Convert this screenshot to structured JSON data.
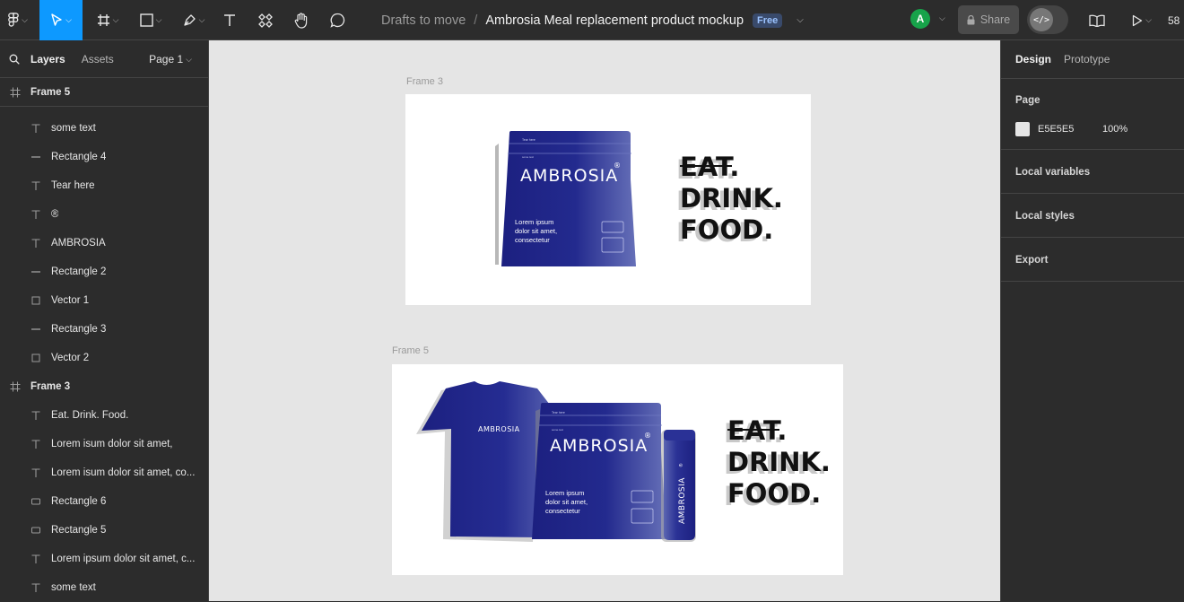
{
  "toolbar": {
    "tools": [
      {
        "name": "main-menu-icon"
      },
      {
        "name": "move-tool-icon",
        "active": true
      },
      {
        "name": "frame-tool-icon"
      },
      {
        "name": "shape-tool-icon"
      },
      {
        "name": "pen-tool-icon"
      },
      {
        "name": "text-tool-icon"
      },
      {
        "name": "components-icon"
      },
      {
        "name": "hand-tool-icon"
      },
      {
        "name": "comment-icon"
      }
    ],
    "breadcrumb_folder": "Drafts to move",
    "breadcrumb_sep": "/",
    "file_title": "Ambrosia Meal replacement product mockup",
    "plan_badge": "Free",
    "avatar_initial": "A",
    "share_label": "Share",
    "zoom_partial": "58"
  },
  "left_panel": {
    "tabs": {
      "layers": "Layers",
      "assets": "Assets"
    },
    "page_selector": "Page 1",
    "layers": [
      {
        "label": "Frame 5",
        "type": "frame"
      },
      {
        "label": "some text",
        "type": "text"
      },
      {
        "label": "Rectangle 4",
        "type": "line"
      },
      {
        "label": "Tear here",
        "type": "text"
      },
      {
        "label": "®",
        "type": "text"
      },
      {
        "label": "AMBROSIA",
        "type": "text"
      },
      {
        "label": "Rectangle 2",
        "type": "line"
      },
      {
        "label": "Vector 1",
        "type": "vector"
      },
      {
        "label": "Rectangle 3",
        "type": "line"
      },
      {
        "label": "Vector 2",
        "type": "vector"
      },
      {
        "label": "Frame 3",
        "type": "frame"
      },
      {
        "label": "Eat. Drink. Food.",
        "type": "text"
      },
      {
        "label": "Lorem isum dolor sit amet,",
        "type": "text"
      },
      {
        "label": "Lorem isum dolor sit amet, co...",
        "type": "text"
      },
      {
        "label": "Rectangle 6",
        "type": "rect"
      },
      {
        "label": "Rectangle 5",
        "type": "rect"
      },
      {
        "label": "Lorem ipsum dolor sit amet, c...",
        "type": "text"
      },
      {
        "label": "some text",
        "type": "text"
      }
    ]
  },
  "canvas": {
    "bg_color": "#E5E5E5",
    "frame3": {
      "label": "Frame 3",
      "brand": "AMBROSIA",
      "reg": "®",
      "tear": "Tear here",
      "small": "some text",
      "body": [
        "Lorem ipsum",
        "dolor sit amet,",
        "consectetur"
      ],
      "slogan": [
        "EAT.",
        "DRINK.",
        "FOOD."
      ]
    },
    "frame5": {
      "label": "Frame 5",
      "brand": "AMBROSIA",
      "reg": "®",
      "tear": "Tear here",
      "small": "some text",
      "body": [
        "Lorem ipsum",
        "dolor sit amet,",
        "consectetur"
      ],
      "slogan": [
        "EAT.",
        "DRINK.",
        "FOOD."
      ]
    }
  },
  "right_panel": {
    "tabs": {
      "design": "Design",
      "prototype": "Prototype"
    },
    "page_heading": "Page",
    "page_color_hex": "E5E5E5",
    "page_opacity": "100%",
    "sections": [
      "Local variables",
      "Local styles",
      "Export"
    ]
  },
  "colors": {
    "accent": "#0d99ff",
    "product_navy": "#1c1f7a",
    "avatar_green": "#17a34a"
  }
}
